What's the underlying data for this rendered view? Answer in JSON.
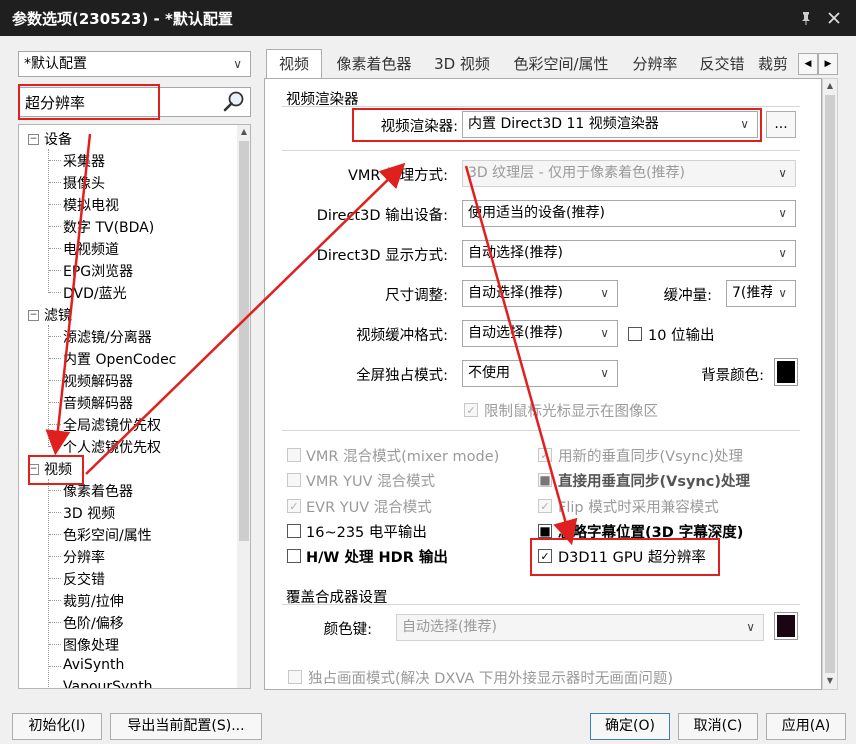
{
  "window": {
    "title": "参数选项(230523) - *默认配置",
    "pin_icon": "pin-icon",
    "close_icon": "close-icon"
  },
  "profile": {
    "value": "*默认配置"
  },
  "search": {
    "value": "超分辨率"
  },
  "tree": {
    "devices": {
      "label": "设备",
      "children": [
        "采集器",
        "摄像头",
        "模拟电视",
        "数字 TV(BDA)",
        "电视频道",
        "EPG浏览器",
        "DVD/蓝光"
      ]
    },
    "filters": {
      "label": "滤镜",
      "children": [
        "源滤镜/分离器",
        "内置 OpenCodec",
        "视频解码器",
        "音频解码器",
        "全局滤镜优先权",
        "个人滤镜优先权"
      ]
    },
    "video": {
      "label": "视频",
      "children": [
        "像素着色器",
        "3D 视频",
        "色彩空间/属性",
        "分辨率",
        "反交错",
        "裁剪/拉伸",
        "色阶/偏移",
        "图像处理",
        "AviSynth",
        "VapourSynth"
      ]
    }
  },
  "tabs": [
    "视频",
    "像素着色器",
    "3D 视频",
    "色彩空间/属性",
    "分辨率",
    "反交错",
    "裁剪"
  ],
  "renderer_group": {
    "title": "视频渲染器",
    "renderer_label": "视频渲染器:",
    "renderer_value": "内置 Direct3D 11 视频渲染器",
    "browse_label": "...",
    "vmr_label": "VMR 处理方式:",
    "vmr_value": "3D 纹理层 - 仅用于像素着色(推荐)",
    "d3d_device_label": "Direct3D 输出设备:",
    "d3d_device_value": "使用适当的设备(推荐)",
    "d3d_display_label": "Direct3D 显示方式:",
    "d3d_display_value": "自动选择(推荐)",
    "size_label": "尺寸调整:",
    "size_value": "自动选择(推荐)",
    "buffer_label": "缓冲量:",
    "buffer_value": "7(推荐",
    "format_label": "视频缓冲格式:",
    "format_value": "自动选择(推荐)",
    "tenbit_label": "10 位输出",
    "fullscreen_label": "全屏独占模式:",
    "fullscreen_value": "不使用",
    "bgcolor_label": "背景颜色:",
    "restrict_cursor_label": "限制鼠标光标显示在图像区"
  },
  "options": {
    "left": [
      {
        "label": "VMR 混合模式(mixer mode)",
        "checked": false,
        "disabled": true,
        "bold": false
      },
      {
        "label": "VMR YUV 混合模式",
        "checked": false,
        "disabled": true,
        "bold": false
      },
      {
        "label": "EVR YUV 混合模式",
        "checked": true,
        "disabled": true,
        "bold": false
      },
      {
        "label": "16~235 电平输出",
        "checked": false,
        "disabled": false,
        "bold": false
      },
      {
        "label": "H/W 处理 HDR 输出",
        "checked": false,
        "disabled": false,
        "bold": true
      }
    ],
    "right": [
      {
        "label": "用新的垂直同步(Vsync)处理",
        "checked": true,
        "disabled": true,
        "bold": false
      },
      {
        "label": "直接用垂直同步(Vsync)处理",
        "checked": false,
        "disabled": true,
        "bold": true,
        "mark": "■"
      },
      {
        "label": "Flip 模式时采用兼容模式",
        "checked": true,
        "disabled": true,
        "bold": false
      },
      {
        "label": "忽略字幕位置(3D 字幕深度)",
        "checked": false,
        "disabled": false,
        "bold": true,
        "mark": "■"
      },
      {
        "label": "D3D11 GPU 超分辨率",
        "checked": true,
        "disabled": false,
        "bold": false
      }
    ]
  },
  "overlay_group": {
    "title": "覆盖合成器设置",
    "colorkey_label": "颜色键:",
    "colorkey_value": "自动选择(推荐)",
    "exclusive_label": "独占画面模式(解决 DXVA 下用外接显示器时无画面问题)"
  },
  "footer": {
    "init_label": "初始化(I)",
    "export_label": "导出当前配置(S)...",
    "ok_label": "确定(O)",
    "cancel_label": "取消(C)",
    "apply_label": "应用(A)"
  },
  "colors": {
    "annotation_red": "#e0201e",
    "titlebar": "#1f1f1f"
  }
}
